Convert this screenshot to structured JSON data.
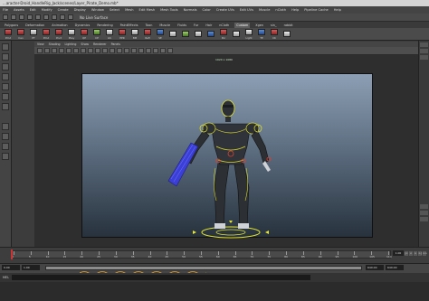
{
  "window": {
    "title": "...aracter-Droid_HandleRig_Jack/scenes/Layer_Pirate_Demo.mb*"
  },
  "menu": [
    "File",
    "Assets",
    "Edit",
    "Modify",
    "Create",
    "Display",
    "Window",
    "Select",
    "Mesh",
    "Edit Mesh",
    "Mesh Tools",
    "Normals",
    "Color",
    "Create UVs",
    "Edit UVs",
    "Muscle",
    "nCloth",
    "Help",
    "Pipeline Cache",
    "Help"
  ],
  "status_line": {
    "no_live_surface": "No Live Surface"
  },
  "shelf_tabs": [
    "Polygons",
    "Deformation",
    "Animation",
    "Dynamics",
    "Rendering",
    "PaintEffects",
    "Toon",
    "Muscle",
    "Fluids",
    "Fur",
    "Hair",
    "nCloth",
    "Custom",
    "Xgen",
    "sin_",
    "rabbit"
  ],
  "shelf_active_tab": "Custom",
  "shelf_tools": [
    {
      "label": "Pmd",
      "color": "r"
    },
    {
      "label": "Cen",
      "color": "r"
    },
    {
      "label": "PT",
      "color": "w"
    },
    {
      "label": "Pmd",
      "color": "r"
    },
    {
      "label": "Pnct",
      "color": "r"
    },
    {
      "label": "Pkey",
      "color": "w"
    },
    {
      "label": "QP",
      "color": "r"
    },
    {
      "label": "CP",
      "color": "g"
    },
    {
      "label": "GS",
      "color": "w"
    },
    {
      "label": "PPR",
      "color": "r"
    },
    {
      "label": "BM",
      "color": "w"
    },
    {
      "label": "Refl",
      "color": "r"
    },
    {
      "label": "SE",
      "color": "b"
    },
    {
      "label": "",
      "color": "w"
    },
    {
      "label": "",
      "color": "g"
    },
    {
      "label": "",
      "color": "w"
    },
    {
      "label": "",
      "color": "b"
    },
    {
      "label": "Pul",
      "color": "r"
    },
    {
      "label": "",
      "color": "w"
    },
    {
      "label": "Light",
      "color": "w"
    },
    {
      "label": "TE",
      "color": "b"
    },
    {
      "label": "CK",
      "color": "r"
    },
    {
      "label": "",
      "color": "w"
    }
  ],
  "panel_menu": [
    "View",
    "Shading",
    "Lighting",
    "Show",
    "Renderer",
    "Panels"
  ],
  "viewport": {
    "resolution": "1920 x 1080",
    "camera_label": "3D Gen(Scale) : persp"
  },
  "timeline": {
    "ticks": [
      "0",
      "5",
      "10",
      "15",
      "20",
      "25",
      "30",
      "35",
      "40",
      "45",
      "50",
      "55",
      "60",
      "65",
      "70",
      "75",
      "80",
      "85",
      "90",
      "95",
      "100",
      "105",
      "110"
    ],
    "current_frame": "1.00"
  },
  "range": {
    "start": "0.00",
    "inner_start": "1.00",
    "inner_end": "640.00",
    "end": "640.00"
  },
  "command_line": {
    "label": "MEL"
  },
  "colors": {
    "rig_yellow": "#e6e62e",
    "rig_red": "#e0402f",
    "rig_blue": "#3b3fd6",
    "timeline_cursor": "#cc3333"
  }
}
